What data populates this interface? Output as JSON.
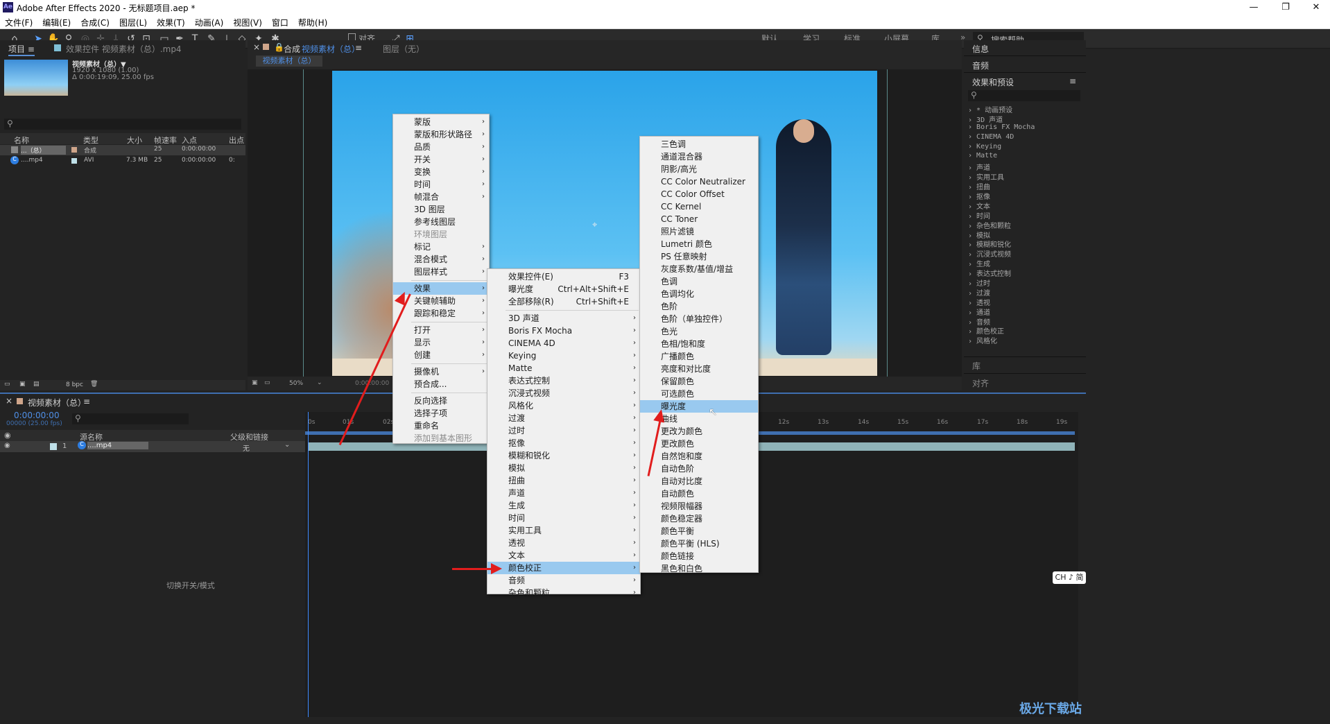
{
  "window": {
    "title": "Adobe After Effects 2020 - 无标题项目.aep *",
    "logo": "Ae"
  },
  "menubar": [
    "文件(F)",
    "编辑(E)",
    "合成(C)",
    "图层(L)",
    "效果(T)",
    "动画(A)",
    "视图(V)",
    "窗口",
    "帮助(H)"
  ],
  "toolbar": {
    "align_label": "对齐",
    "workspaces": [
      "默认",
      "学习",
      "标准",
      "小屏幕",
      "库"
    ],
    "search_placeholder": "搜索帮助"
  },
  "project": {
    "tab": "项目",
    "effects_tab": "效果控件 视频素材（总）.mp4",
    "item_name": "视频素材（总）▼",
    "item_res": "1920 x 1080 (1.00)",
    "item_dur": "Δ 0:00:19:09, 25.00 fps",
    "columns": [
      "名称",
      "类型",
      "大小",
      "帧速率",
      "入点",
      "出点"
    ],
    "rows": [
      {
        "name": "...（总）",
        "type": "合成",
        "size": "",
        "fps": "25",
        "in": "0:00:00:00",
        "out": ""
      },
      {
        "name": "....mp4",
        "type": "AVI",
        "size": "7.3 MB",
        "fps": "25",
        "in": "0:00:00:00",
        "out": "0:"
      }
    ],
    "bpc": "8 bpc"
  },
  "comp": {
    "tab_prefix": "合成",
    "tab_name": "视频素材（总）",
    "layer_tab": "图层（无）",
    "sub_tab": "视频素材（总）",
    "zoom": "50%",
    "time": "0:00:00:00"
  },
  "right_panel": {
    "info": "信息",
    "audio": "音频",
    "effects_presets": "效果和预设",
    "library": "库",
    "align": "对齐",
    "categories": [
      "* 动画预设",
      "3D 声道",
      "Boris FX Mocha",
      "CINEMA 4D",
      "Keying",
      "Matte",
      "声道",
      "实用工具",
      "扭曲",
      "抠像",
      "文本",
      "时间",
      "杂色和颗粒",
      "模拟",
      "模糊和锐化",
      "沉浸式视频",
      "生成",
      "表达式控制",
      "过时",
      "过渡",
      "透视",
      "通道",
      "音频",
      "颜色校正",
      "风格化"
    ]
  },
  "timeline": {
    "tab": "视频素材（总）",
    "timecode": "0:00:00:00",
    "fps_label": "00000 (25.00 fps)",
    "col_source": "源名称",
    "col_parent": "父级和链接",
    "layer_num": "1",
    "layer_name": "....mp4",
    "parent_value": "无",
    "switch_label": "切换开关/模式",
    "ticks": [
      "0s",
      "01s",
      "02s",
      "12s",
      "13s",
      "14s",
      "15s",
      "16s",
      "17s",
      "18s",
      "19s"
    ]
  },
  "context_menu": [
    {
      "label": "蒙版",
      "sub": true
    },
    {
      "label": "蒙版和形状路径",
      "sub": true
    },
    {
      "label": "品质",
      "sub": true
    },
    {
      "label": "开关",
      "sub": true
    },
    {
      "label": "变换",
      "sub": true
    },
    {
      "label": "时间",
      "sub": true
    },
    {
      "label": "帧混合",
      "sub": true
    },
    {
      "label": "3D 图层"
    },
    {
      "label": "参考线图层"
    },
    {
      "label": "环境图层",
      "dis": true
    },
    {
      "label": "标记",
      "sub": true
    },
    {
      "label": "混合模式",
      "sub": true
    },
    {
      "label": "图层样式",
      "sub": true
    },
    {
      "sep": true
    },
    {
      "label": "效果",
      "sub": true,
      "hl": true
    },
    {
      "label": "关键帧辅助",
      "sub": true
    },
    {
      "label": "跟踪和稳定",
      "sub": true
    },
    {
      "sep": true
    },
    {
      "label": "打开",
      "sub": true
    },
    {
      "label": "显示",
      "sub": true
    },
    {
      "label": "创建",
      "sub": true
    },
    {
      "sep": true
    },
    {
      "label": "摄像机",
      "sub": true
    },
    {
      "label": "预合成..."
    },
    {
      "sep": true
    },
    {
      "label": "反向选择"
    },
    {
      "label": "选择子项"
    },
    {
      "label": "重命名"
    },
    {
      "label": "添加到基本图形",
      "dis": true
    }
  ],
  "effects_menu": [
    {
      "label": "效果控件(E)",
      "sc": "F3"
    },
    {
      "label": "曝光度",
      "sc": "Ctrl+Alt+Shift+E"
    },
    {
      "label": "全部移除(R)",
      "sc": "Ctrl+Shift+E"
    },
    {
      "sep": true
    },
    {
      "label": "3D 声道",
      "sub": true
    },
    {
      "label": "Boris FX Mocha",
      "sub": true
    },
    {
      "label": "CINEMA 4D",
      "sub": true
    },
    {
      "label": "Keying",
      "sub": true
    },
    {
      "label": "Matte",
      "sub": true
    },
    {
      "label": "表达式控制",
      "sub": true
    },
    {
      "label": "沉浸式视频",
      "sub": true
    },
    {
      "label": "风格化",
      "sub": true
    },
    {
      "label": "过渡",
      "sub": true
    },
    {
      "label": "过时",
      "sub": true
    },
    {
      "label": "抠像",
      "sub": true
    },
    {
      "label": "模糊和锐化",
      "sub": true
    },
    {
      "label": "模拟",
      "sub": true
    },
    {
      "label": "扭曲",
      "sub": true
    },
    {
      "label": "声道",
      "sub": true
    },
    {
      "label": "生成",
      "sub": true
    },
    {
      "label": "时间",
      "sub": true
    },
    {
      "label": "实用工具",
      "sub": true
    },
    {
      "label": "透视",
      "sub": true
    },
    {
      "label": "文本",
      "sub": true
    },
    {
      "label": "颜色校正",
      "sub": true,
      "hl": true
    },
    {
      "label": "音频",
      "sub": true
    },
    {
      "label": "杂色和颗粒",
      "sub": true
    }
  ],
  "color_menu": [
    {
      "label": "三色调"
    },
    {
      "label": "通道混合器"
    },
    {
      "label": "阴影/高光"
    },
    {
      "label": "CC Color Neutralizer"
    },
    {
      "label": "CC Color Offset"
    },
    {
      "label": "CC Kernel"
    },
    {
      "label": "CC Toner"
    },
    {
      "label": "照片滤镜"
    },
    {
      "label": "Lumetri 颜色"
    },
    {
      "label": "PS 任意映射"
    },
    {
      "label": "灰度系数/基值/增益"
    },
    {
      "label": "色调"
    },
    {
      "label": "色调均化"
    },
    {
      "label": "色阶"
    },
    {
      "label": "色阶（单独控件）"
    },
    {
      "label": "色光"
    },
    {
      "label": "色相/饱和度"
    },
    {
      "label": "广播颜色"
    },
    {
      "label": "亮度和对比度"
    },
    {
      "label": "保留颜色"
    },
    {
      "label": "可选颜色"
    },
    {
      "label": "曝光度",
      "hl": true
    },
    {
      "label": "曲线"
    },
    {
      "label": "更改为颜色"
    },
    {
      "label": "更改颜色"
    },
    {
      "label": "自然饱和度"
    },
    {
      "label": "自动色阶"
    },
    {
      "label": "自动对比度"
    },
    {
      "label": "自动颜色"
    },
    {
      "label": "视频限幅器"
    },
    {
      "label": "颜色稳定器"
    },
    {
      "label": "颜色平衡"
    },
    {
      "label": "颜色平衡 (HLS)"
    },
    {
      "label": "颜色链接"
    },
    {
      "label": "黑色和白色"
    }
  ],
  "watermark": "极光下载站",
  "ime": "CH ♪ 简"
}
